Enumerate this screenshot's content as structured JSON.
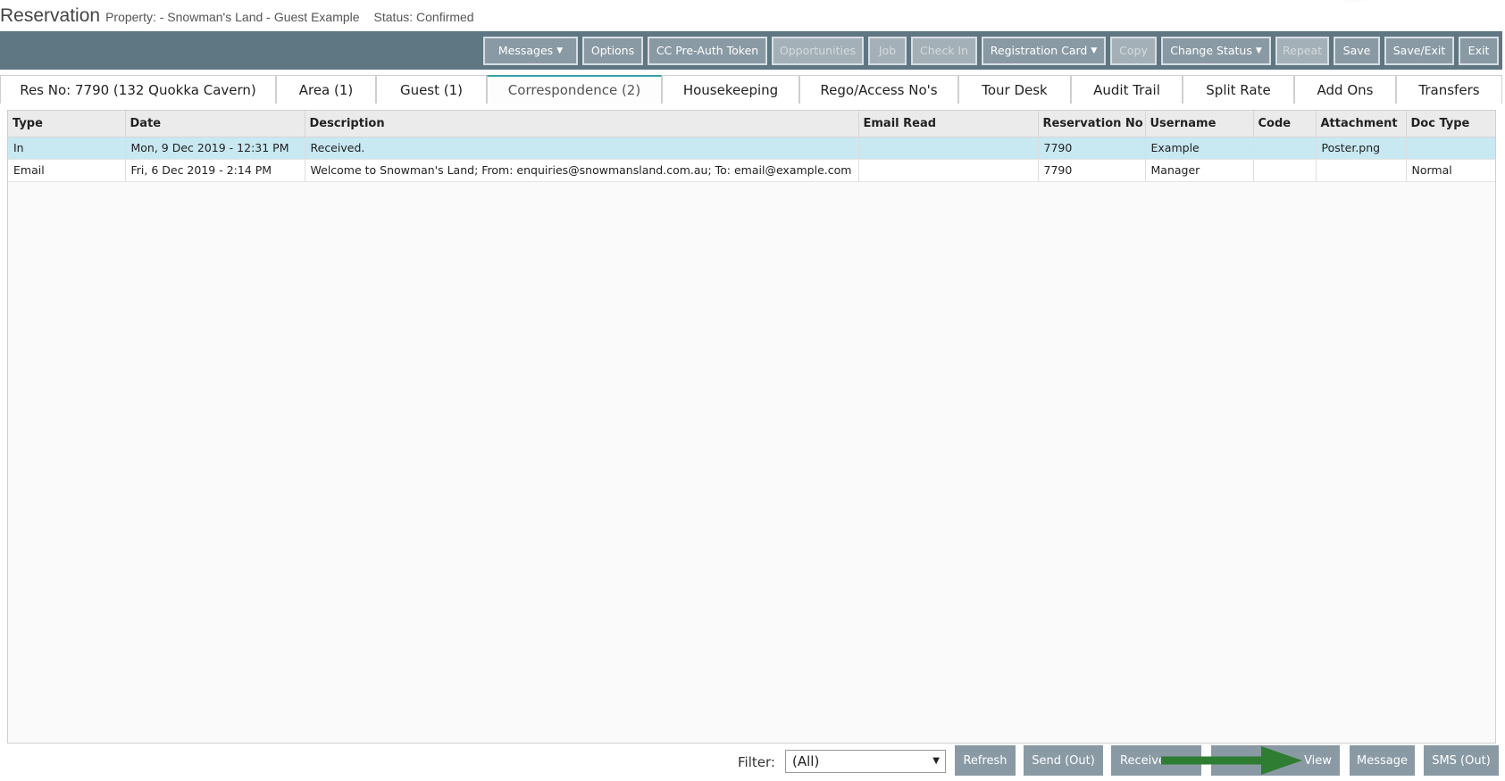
{
  "header": {
    "title": "Reservation",
    "property": "Property: - Snowman's Land -",
    "guest": "Guest Example",
    "status": "Status: Confirmed"
  },
  "toolbar": {
    "messages": "Messages",
    "options": "Options",
    "cc_preauth": "CC Pre-Auth Token",
    "opportunities": "Opportunities",
    "job": "Job",
    "check_in": "Check In",
    "registration_card": "Registration Card",
    "copy": "Copy",
    "change_status": "Change Status",
    "repeat": "Repeat",
    "save": "Save",
    "save_exit": "Save/Exit",
    "exit": "Exit"
  },
  "tabs": [
    {
      "label": "Res No: 7790 (132 Quokka Cavern)"
    },
    {
      "label": "Area (1)"
    },
    {
      "label": "Guest (1)"
    },
    {
      "label": "Correspondence (2)"
    },
    {
      "label": "Housekeeping"
    },
    {
      "label": "Rego/Access No's"
    },
    {
      "label": "Tour Desk"
    },
    {
      "label": "Audit Trail"
    },
    {
      "label": "Split Rate"
    },
    {
      "label": "Add Ons"
    },
    {
      "label": "Transfers"
    }
  ],
  "grid": {
    "columns": [
      "Type",
      "Date",
      "Description",
      "Email Read",
      "Reservation No",
      "Username",
      "Code",
      "Attachment",
      "Doc Type"
    ],
    "rows": [
      [
        "In",
        "Mon, 9 Dec 2019 - 12:31 PM",
        "Received.",
        "",
        "7790",
        "Example",
        "",
        "Poster.png",
        ""
      ],
      [
        "Email",
        "Fri, 6 Dec 2019 - 2:14 PM",
        "Welcome to Snowman's Land; From: enquiries@snowmansland.com.au; To: email@example.com",
        "",
        "7790",
        "Manager",
        "",
        "",
        "Normal"
      ]
    ]
  },
  "bottom": {
    "filter_label": "Filter:",
    "filter_value": "(All)",
    "refresh": "Refresh",
    "send_out": "Send (Out)",
    "receive": "Receive",
    "view": "View",
    "message": "Message",
    "sms_out": "SMS (Out)"
  },
  "colors": {
    "toolbar_bg": "#5f7683",
    "button_bg": "#8a9aa4",
    "selected_row": "#c8e8f2",
    "active_tab_accent": "#3aa0a8",
    "arrow": "#2e7d32"
  },
  "icons": {
    "dropdown_caret": "caret-down-icon",
    "annotation_arrow": "arrow-right-icon"
  }
}
